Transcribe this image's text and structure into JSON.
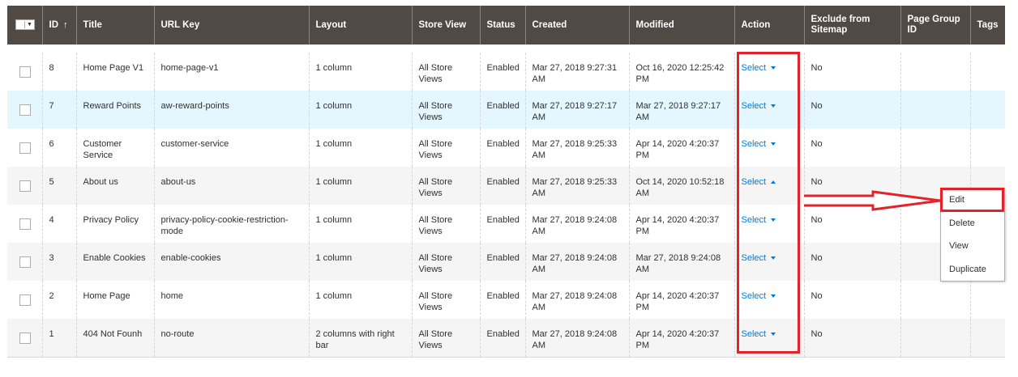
{
  "header": {
    "mass_action_icon": "checkbox-dropdown-icon",
    "columns": {
      "id": "ID",
      "sort_indicator": "↑",
      "title": "Title",
      "url_key": "URL Key",
      "layout": "Layout",
      "store_view": "Store View",
      "status": "Status",
      "created": "Created",
      "modified": "Modified",
      "action": "Action",
      "exclude_sitemap": "Exclude from Sitemap",
      "page_group_id": "Page Group ID",
      "tags": "Tags"
    }
  },
  "rows": [
    {
      "id": "8",
      "title": "Home Page V1",
      "url_key": "home-page-v1",
      "layout": "1 column",
      "store_view": "All Store Views",
      "status": "Enabled",
      "created": "Mar 27, 2018 9:27:31 AM",
      "modified": "Oct 16, 2020 12:25:42 PM",
      "action": "Select",
      "exclude": "No",
      "page_group": "",
      "tags": ""
    },
    {
      "id": "7",
      "title": "Reward Points",
      "url_key": "aw-reward-points",
      "layout": "1 column",
      "store_view": "All Store Views",
      "status": "Enabled",
      "created": "Mar 27, 2018 9:27:17 AM",
      "modified": "Mar 27, 2018 9:27:17 AM",
      "action": "Select",
      "exclude": "No",
      "page_group": "",
      "tags": ""
    },
    {
      "id": "6",
      "title": "Customer Service",
      "url_key": "customer-service",
      "layout": "1 column",
      "store_view": "All Store Views",
      "status": "Enabled",
      "created": "Mar 27, 2018 9:25:33 AM",
      "modified": "Apr 14, 2020 4:20:37 PM",
      "action": "Select",
      "exclude": "No",
      "page_group": "",
      "tags": ""
    },
    {
      "id": "5",
      "title": "About us",
      "url_key": "about-us",
      "layout": "1 column",
      "store_view": "All Store Views",
      "status": "Enabled",
      "created": "Mar 27, 2018 9:25:33 AM",
      "modified": "Oct 14, 2020 10:52:18 AM",
      "action": "Select",
      "exclude": "No",
      "page_group": "",
      "tags": ""
    },
    {
      "id": "4",
      "title": "Privacy Policy",
      "url_key": "privacy-policy-cookie-restriction-mode",
      "layout": "1 column",
      "store_view": "All Store Views",
      "status": "Enabled",
      "created": "Mar 27, 2018 9:24:08 AM",
      "modified": "Apr 14, 2020 4:20:37 PM",
      "action": "Select",
      "exclude": "No",
      "page_group": "",
      "tags": ""
    },
    {
      "id": "3",
      "title": "Enable Cookies",
      "url_key": "enable-cookies",
      "layout": "1 column",
      "store_view": "All Store Views",
      "status": "Enabled",
      "created": "Mar 27, 2018 9:24:08 AM",
      "modified": "Mar 27, 2018 9:24:08 AM",
      "action": "Select",
      "exclude": "No",
      "page_group": "",
      "tags": ""
    },
    {
      "id": "2",
      "title": "Home Page",
      "url_key": "home",
      "layout": "1 column",
      "store_view": "All Store Views",
      "status": "Enabled",
      "created": "Mar 27, 2018 9:24:08 AM",
      "modified": "Apr 14, 2020 4:20:37 PM",
      "action": "Select",
      "exclude": "No",
      "page_group": "",
      "tags": ""
    },
    {
      "id": "1",
      "title": "404 Not Founh",
      "url_key": "no-route",
      "layout": "2 columns with right bar",
      "store_view": "All Store Views",
      "status": "Enabled",
      "created": "Mar 27, 2018 9:24:08 AM",
      "modified": "Apr 14, 2020 4:20:37 PM",
      "action": "Select",
      "exclude": "No",
      "page_group": "",
      "tags": ""
    }
  ],
  "action_menu": {
    "edit": "Edit",
    "delete": "Delete",
    "view": "View",
    "duplicate": "Duplicate"
  },
  "colors": {
    "header_bg": "#514943",
    "link": "#007bdb",
    "highlight": "#e3222b",
    "row_hover": "#e5f7fe"
  }
}
